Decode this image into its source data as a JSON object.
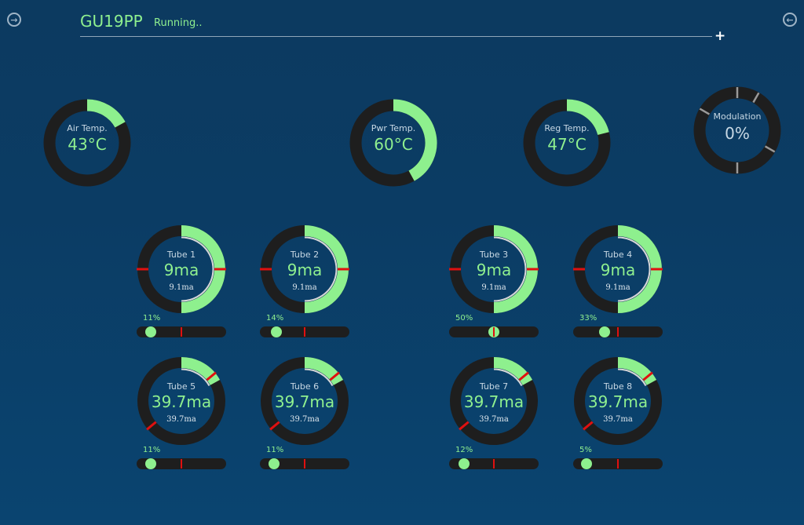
{
  "header": {
    "title": "GU19PP",
    "status": "Running..",
    "left_nav_icon": "arrow-right-circle-icon",
    "right_nav_icon": "arrow-left-circle-icon",
    "plus_label": "+"
  },
  "colors": {
    "accent": "#8ef08e",
    "ring": "#1e1e1e",
    "marker": "#e01010",
    "background": "#0b3c64"
  },
  "gauges": {
    "air": {
      "label": "Air Temp.",
      "value": "43°C",
      "fill": 0.17
    },
    "pwr": {
      "label": "Pwr Temp.",
      "value": "60°C",
      "fill": 0.42
    },
    "reg": {
      "label": "Reg Temp.",
      "value": "47°C",
      "fill": 0.21
    },
    "mod": {
      "label": "Modulation",
      "value": "0%",
      "fill": 0
    }
  },
  "tubes": [
    {
      "label": "Tube 1",
      "value": "9ma",
      "sub": "9.1ma",
      "pct": "11%",
      "level": 0.11,
      "fill": 0.5
    },
    {
      "label": "Tube 2",
      "value": "9ma",
      "sub": "9.1ma",
      "pct": "14%",
      "level": 0.14,
      "fill": 0.5
    },
    {
      "label": "Tube 3",
      "value": "9ma",
      "sub": "9.1ma",
      "pct": "50%",
      "level": 0.5,
      "fill": 0.5
    },
    {
      "label": "Tube 4",
      "value": "9ma",
      "sub": "9.1ma",
      "pct": "33%",
      "level": 0.33,
      "fill": 0.5
    },
    {
      "label": "Tube 5",
      "value": "39.7ma",
      "sub": "39.7ma",
      "pct": "11%",
      "level": 0.11,
      "fill": 0.17
    },
    {
      "label": "Tube 6",
      "value": "39.7ma",
      "sub": "39.7ma",
      "pct": "11%",
      "level": 0.11,
      "fill": 0.17
    },
    {
      "label": "Tube 7",
      "value": "39.7ma",
      "sub": "39.7ma",
      "pct": "12%",
      "level": 0.12,
      "fill": 0.17
    },
    {
      "label": "Tube 8",
      "value": "39.7ma",
      "sub": "39.7ma",
      "pct": "5%",
      "level": 0.05,
      "fill": 0.17
    }
  ]
}
